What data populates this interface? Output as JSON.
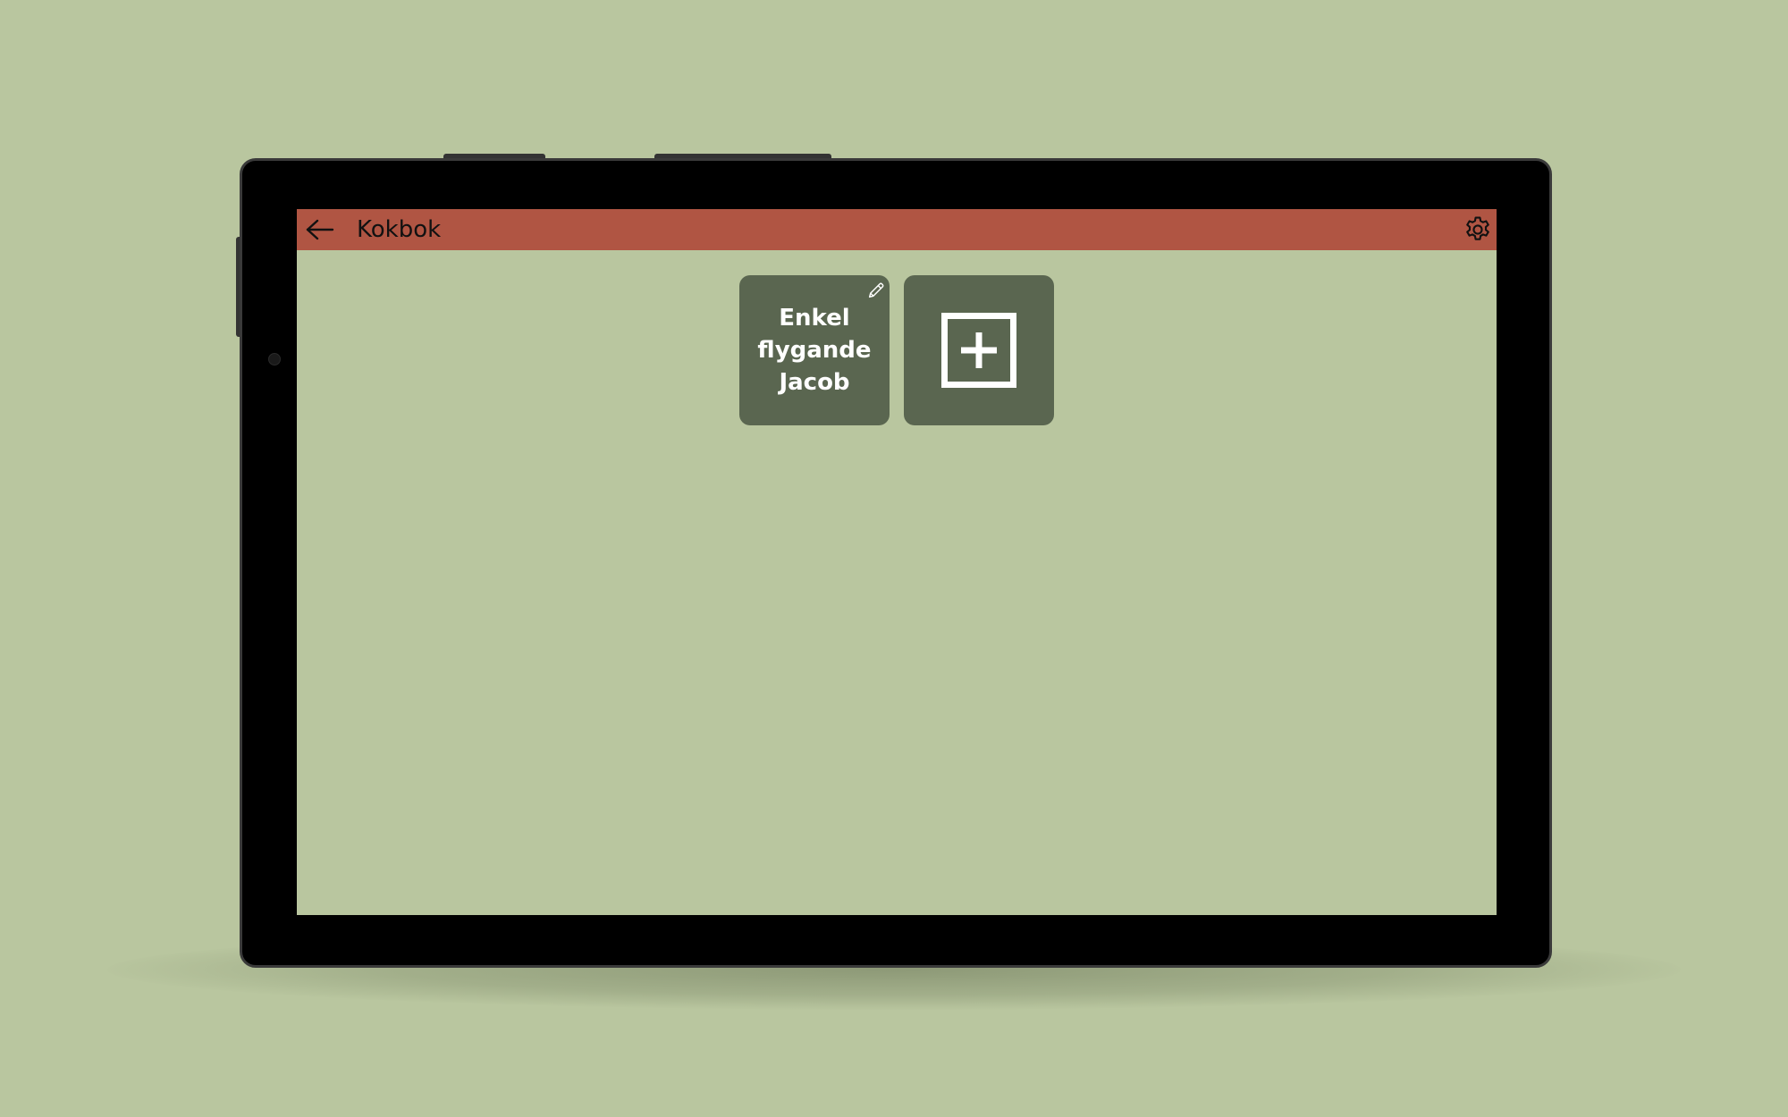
{
  "app": {
    "title": "Kokbok"
  },
  "appbar": {
    "background": "#b05543",
    "back_icon": "arrow-left-icon",
    "settings_icon": "gear-icon"
  },
  "recipes": [
    {
      "name": "Enkel flygande Jacob",
      "edit_icon": "pencil-icon"
    }
  ],
  "add_tile": {
    "icon": "plus-square-icon"
  },
  "colors": {
    "background": "#b9c69f",
    "tile": "#5a6650",
    "tile_text": "#ffffff"
  }
}
